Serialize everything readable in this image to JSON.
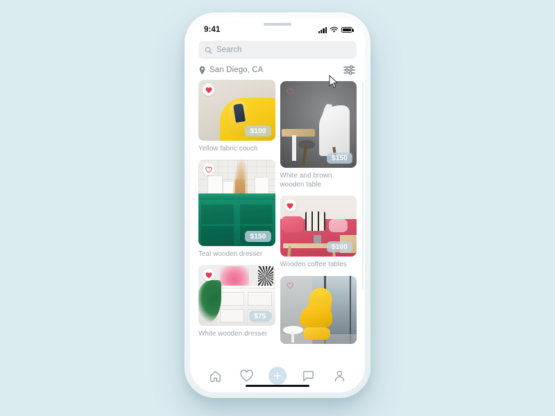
{
  "device": {
    "status_bar": {
      "clock": "9:41",
      "signal_icon": "cellular-signal-icon",
      "wifi_icon": "wifi-icon",
      "battery_icon": "battery-full-icon"
    }
  },
  "search": {
    "icon": "search-icon",
    "placeholder": "Search",
    "value": ""
  },
  "location": {
    "pin_icon": "location-pin-icon",
    "text": "San Diego, CA",
    "filter_icon": "filter-sliders-icon"
  },
  "listings": {
    "left_column": [
      {
        "title": "Yellow fabric couch",
        "price": "$100",
        "favorited": true,
        "heart_icon": "heart-filled-icon",
        "image": "yellow-fabric-couch-photo"
      },
      {
        "title": "Teal wooden dresser",
        "price": "$150",
        "favorited": false,
        "heart_icon": "heart-outline-icon",
        "image": "teal-wooden-dresser-photo"
      },
      {
        "title": "White wooden dresser",
        "price": "$75",
        "favorited": true,
        "heart_icon": "heart-filled-icon",
        "image": "white-wooden-dresser-photo"
      }
    ],
    "right_column": [
      {
        "title": "White and brown wooden table",
        "price": "$150",
        "favorited": false,
        "heart_icon": "heart-outline-icon",
        "image": "white-brown-wooden-table-photo"
      },
      {
        "title": "Wooden coffee tables",
        "price": "$100",
        "favorited": true,
        "heart_icon": "heart-filled-icon",
        "image": "wooden-coffee-tables-photo"
      },
      {
        "title": "",
        "price": "",
        "favorited": false,
        "heart_icon": "heart-outline-icon",
        "image": "yellow-chair-window-photo"
      }
    ]
  },
  "tabbar": {
    "items": [
      {
        "icon": "home-icon",
        "label": "Home",
        "active": false
      },
      {
        "icon": "heart-icon",
        "label": "Favorites",
        "active": false
      },
      {
        "icon": "plus-icon",
        "label": "Add listing",
        "active": true
      },
      {
        "icon": "chat-bubble-icon",
        "label": "Messages",
        "active": false
      },
      {
        "icon": "person-icon",
        "label": "Profile",
        "active": false
      }
    ]
  },
  "colors": {
    "page_background": "#dbecf1",
    "accent_blue": "#cfe2ed",
    "heart_red": "#e8384f",
    "price_badge": "rgba(189,210,222,.82)",
    "muted_text": "#9aa1a8"
  },
  "cursor": {
    "icon": "mouse-pointer-icon"
  }
}
